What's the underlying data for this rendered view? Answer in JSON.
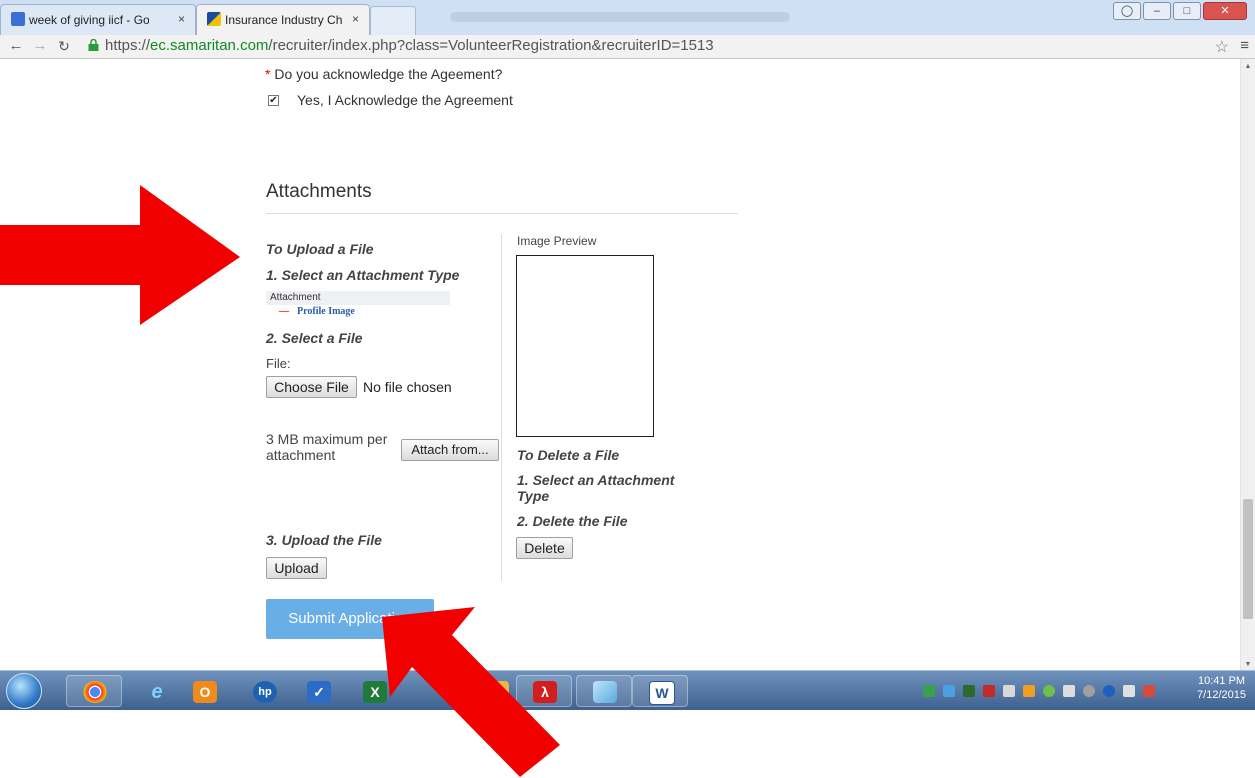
{
  "browser": {
    "tabs": [
      {
        "title": "week of giving iicf - Goog",
        "close": "×"
      },
      {
        "title": "Insurance Industry Charita",
        "close": "×"
      }
    ],
    "url_scheme": "https://",
    "url_host": "ec.samaritan.com",
    "url_path": "/recruiter/index.php?class=VolunteerRegistration&recruiterID=1513"
  },
  "form": {
    "agreement": {
      "required_mark": "*",
      "question": "Do you acknowledge the Ageement?",
      "option_label": "Yes, I Acknowledge the Agreement",
      "checked": true
    },
    "attachments": {
      "heading": "Attachments",
      "upload": {
        "title": "To Upload a File",
        "step1": "1. Select an Attachment Type",
        "type_list_header": "Attachment",
        "type_list_item": "Profile Image",
        "step2": "2. Select a File",
        "file_label": "File:",
        "choose_button": "Choose File",
        "no_file_text": "No file chosen",
        "max_size_note": "3 MB maximum per attachment",
        "attach_from_button": "Attach from...",
        "step3": "3. Upload the File",
        "upload_button": "Upload"
      },
      "preview": {
        "label": "Image Preview"
      },
      "delete": {
        "title": "To Delete a File",
        "step1": "1. Select an Attachment Type",
        "step2": "2. Delete the File",
        "delete_button": "Delete"
      }
    },
    "submit_button": "Submit Application"
  },
  "taskbar": {
    "apps": [
      "chrome-icon",
      "internet-explorer-icon",
      "outlook-icon",
      "hp-icon",
      "checkmark-app-icon",
      "excel-icon",
      "folder-icon",
      "acrobat-icon",
      "notes-icon",
      "word-icon"
    ],
    "clock_time": "10:41 PM",
    "clock_date": "7/12/2015"
  },
  "colors": {
    "submit_bg": "#6aaee6",
    "arrow_red": "#f20000",
    "url_host": "#128a1e"
  }
}
